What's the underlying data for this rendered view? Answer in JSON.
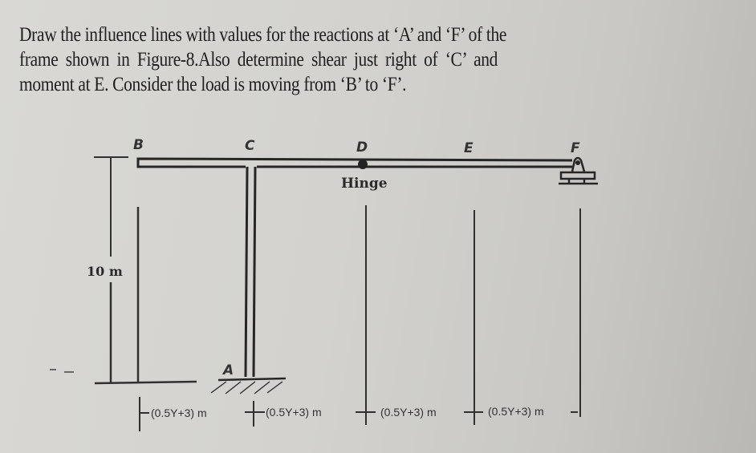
{
  "question": {
    "line1": "Draw the influence lines with values for the reactions at ‘A’ and ‘F’ of the",
    "line2": "frame shown in Figure-8.Also   determine shear just right of ‘C’ and",
    "line3": "moment at E. Consider the load is moving from ‘B’ to ‘F’."
  },
  "figure": {
    "name": "Figure-8",
    "points": {
      "B": "B",
      "C": "C",
      "D": "D",
      "E": "E",
      "F": "F",
      "A": "A"
    },
    "hinge_label": "Hinge",
    "height_label": "10 m",
    "spans": [
      "(0.5Y+3) m",
      "(0.5Y+3) m",
      "(0.5Y+3) m",
      "(0.5Y+3) m"
    ]
  }
}
